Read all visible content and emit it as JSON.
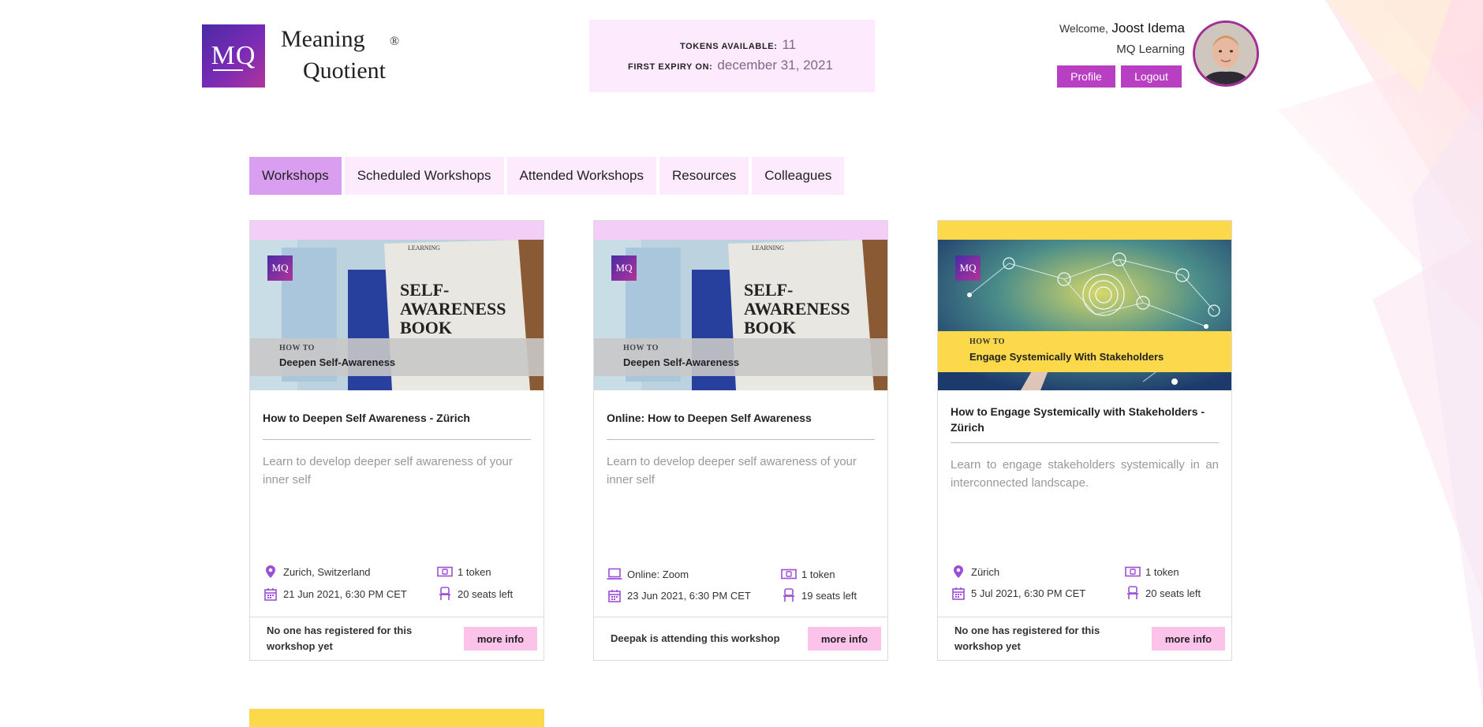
{
  "brand": {
    "logo_initials": "MQ",
    "name_line1": "Meaning",
    "name_line2": "Quotient",
    "registered": "®"
  },
  "tokens": {
    "available_label": "TOKENS AVAILABLE:",
    "available_value": "11",
    "expiry_label": "FIRST EXPIRY ON:",
    "expiry_value": "december 31, 2021"
  },
  "user": {
    "welcome_label": "Welcome,",
    "name": "Joost Idema",
    "organization": "MQ Learning",
    "profile_button": "Profile",
    "logout_button": "Logout"
  },
  "tabs": [
    {
      "label": "Workshops",
      "active": true
    },
    {
      "label": "Scheduled Workshops",
      "active": false
    },
    {
      "label": "Attended Workshops",
      "active": false
    },
    {
      "label": "Resources",
      "active": false
    },
    {
      "label": "Colleagues",
      "active": false
    }
  ],
  "workshops": [
    {
      "strip_color": "#f3cff7",
      "image": {
        "howto": "HOW TO",
        "headline": "Deepen Self-Awareness",
        "book_text": [
          "SELF-",
          "AWARENESS",
          "BOOK"
        ],
        "mq_learning": "LEARNING",
        "mq": "MQ"
      },
      "title": "How to Deepen Self Awareness - Zürich",
      "description": "Learn to develop deeper self awareness of your inner self",
      "location_icon": "map-pin-icon",
      "location": "Zurich, Switzerland",
      "date": "21 Jun 2021, 6:30 PM CET",
      "cost": "1 token",
      "seats": "20 seats left",
      "footer_message": "No one has registered for this workshop yet",
      "more_label": "more info"
    },
    {
      "strip_color": "#f3cff7",
      "image": {
        "howto": "HOW TO",
        "headline": "Deepen Self-Awareness",
        "book_text": [
          "SELF-",
          "AWARENESS",
          "BOOK"
        ],
        "mq_learning": "LEARNING",
        "mq": "MQ"
      },
      "title": "Online: How to Deepen Self Awareness",
      "description": "Learn to develop deeper self awareness of your inner self",
      "location_icon": "laptop-icon",
      "location": "Online: Zoom",
      "date": "23 Jun 2021, 6:30 PM CET",
      "cost": "1 token",
      "seats": "19 seats left",
      "footer_message": "Deepak is attending this workshop",
      "more_label": "more info"
    },
    {
      "strip_color": "#fcd94a",
      "image": {
        "howto": "HOW TO",
        "headline": "Engage Systemically With Stakeholders",
        "mq": "MQ"
      },
      "title": "How to Engage Systemically with Stakeholders - Zürich",
      "description": "Learn to engage stakeholders systemically in an interconnected landscape.",
      "location_icon": "map-pin-icon",
      "location": "Zürich",
      "date": "5 Jul 2021, 6:30 PM CET",
      "cost": "1 token",
      "seats": "20 seats left",
      "footer_message": "No one has registered for this workshop yet",
      "more_label": "more info"
    }
  ],
  "colors": {
    "accent": "#b83fc1",
    "tab_active": "#d99ef0",
    "tab_bg": "#fdeafd",
    "more_button": "#fbc2ea",
    "icon_purple": "#9b4fd6"
  }
}
